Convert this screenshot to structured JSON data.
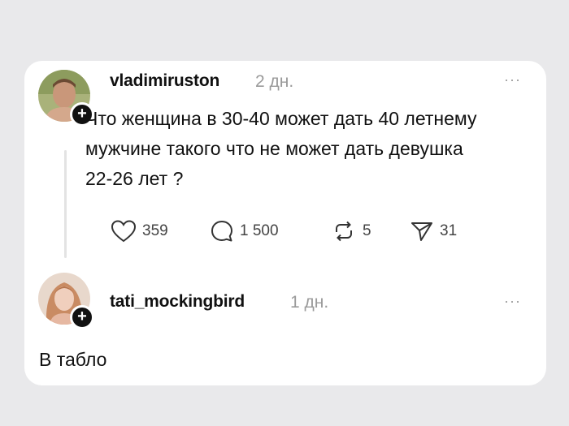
{
  "post": {
    "username": "vladimiruston",
    "time": "2 дн.",
    "more": "···",
    "text": "Что женщина в 30-40 может дать 40 летнему мужчине такого что не может дать девушка 22-26 лет ?",
    "actions": {
      "likes": "359",
      "comments": "1 500",
      "reposts": "5",
      "shares": "31"
    }
  },
  "reply": {
    "username": "tati_mockingbird",
    "time": "1 дн.",
    "more": "···",
    "text": "В табло"
  },
  "icons": {
    "like": "heart-icon",
    "comment": "comment-icon",
    "repost": "repost-icon",
    "share": "send-icon",
    "follow": "plus-icon"
  },
  "colors": {
    "background": "#e9e9eb",
    "card": "#ffffff",
    "text": "#111111",
    "muted": "#9a9a9a"
  }
}
